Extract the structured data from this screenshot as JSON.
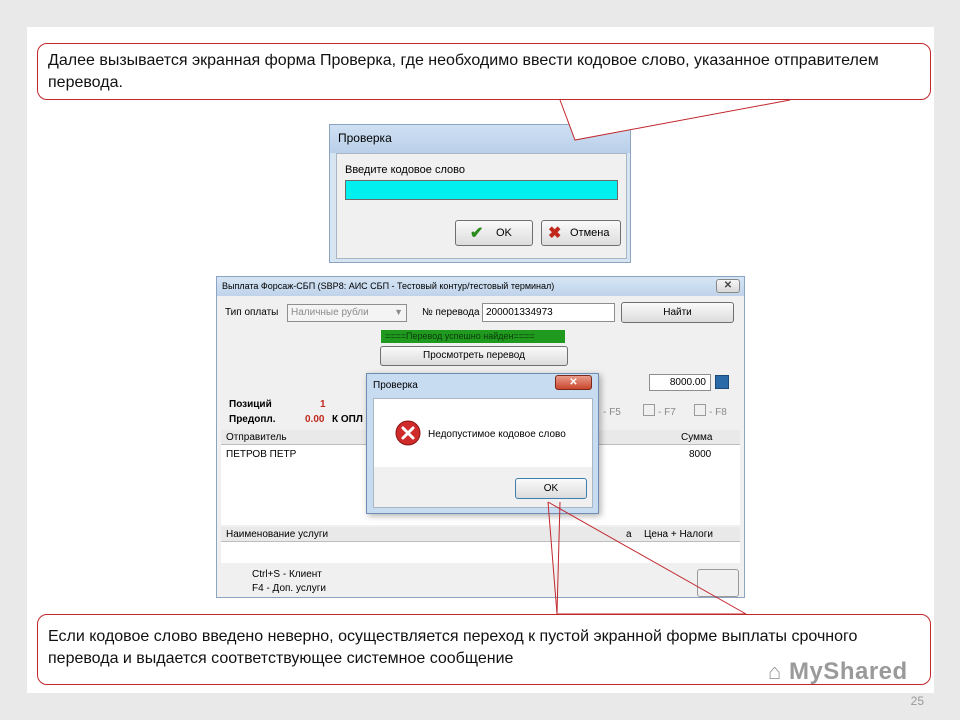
{
  "slide": {
    "callout_top": "Далее вызывается экранная форма Проверка, где необходимо ввести кодовое слово, указанное отправителем перевода.",
    "callout_bottom": "Если кодовое слово введено неверно, осуществляется переход к пустой экранной форме выплаты срочного перевода и выдается соответствующее системное сообщение",
    "page_number": "25",
    "watermark": "MyShared"
  },
  "dialog_input": {
    "title": "Проверка",
    "prompt": "Введите кодовое слово",
    "value": "",
    "ok_label": "OK",
    "cancel_label": "Отмена",
    "field_color": "#00f0f0"
  },
  "payout_window": {
    "title": "Выплата Форсаж-СБП (SBP8: АИС СБП - Тестовый контур/тестовый терминал)",
    "payment_type_label": "Тип оплаты",
    "payment_type_value": "Наличные рубли",
    "transfer_no_label": "№ перевода",
    "transfer_no_value": "200001334973",
    "find_button": "Найти",
    "status_text": "====Перевод успешно найден====",
    "status_color": "#1f9a1f",
    "view_button": "Просмотреть перевод",
    "amount_value": "8000.00",
    "positions_label": "Позиций",
    "positions_value": "1",
    "prepay_label": "Предопл.",
    "prepay_value": "0.00",
    "to_pay_label": "К ОПЛ",
    "f5": "- F5",
    "f7": "- F7",
    "f8": "- F8",
    "sender_header": "Отправитель",
    "sum_header": "Сумма",
    "sender_value": "ПЕТРОВ ПЕТР",
    "sum_value": "8000",
    "service_header": "Наименование услуги",
    "service_header_cut": "а",
    "price_header": "Цена + Налоги",
    "shortcut1": "Ctrl+S - Клиент",
    "shortcut2": "F4 - Доп. услуги"
  },
  "error_dialog": {
    "title": "Проверка",
    "message": "Недопустимое кодовое слово",
    "ok_label": "OK",
    "icon": "error-icon"
  }
}
